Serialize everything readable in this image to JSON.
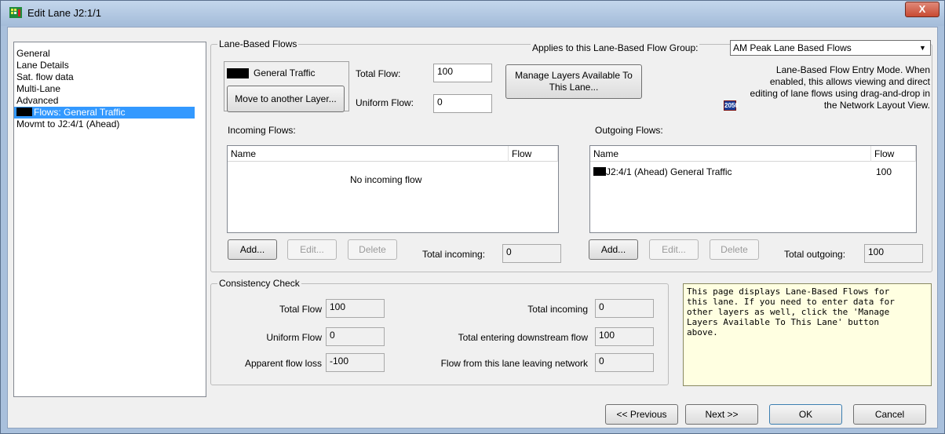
{
  "window": {
    "title": "Edit Lane J2:1/1",
    "close_glyph": "X",
    "app_icon": "junction-grid-icon"
  },
  "sidebar": {
    "items": [
      {
        "label": "General"
      },
      {
        "label": "Lane Details"
      },
      {
        "label": "Sat. flow data"
      },
      {
        "label": "Multi-Lane"
      },
      {
        "label": "Advanced"
      },
      {
        "label": "Flows: General Traffic",
        "selected": true
      },
      {
        "label": "Movmt to J2:4/1 (Ahead)"
      }
    ]
  },
  "lane_flows": {
    "group_title": "Lane-Based Flows",
    "applies_label": "Applies to this Lane-Based Flow Group:",
    "applies_value": "AM Peak Lane Based Flows",
    "layer_name": "General Traffic",
    "move_button": "Move to another Layer...",
    "total_flow_label": "Total Flow:",
    "total_flow_value": "100",
    "uniform_flow_label": "Uniform Flow:",
    "uniform_flow_value": "0",
    "manage_button": "Manage Layers Available To This Lane...",
    "mode_icon_text": "2050",
    "mode_text": "Lane-Based Flow Entry Mode. When enabled, this allows viewing and direct editing of lane flows using drag-and-drop in the Network Layout View."
  },
  "incoming": {
    "title": "Incoming Flows:",
    "columns": [
      "Name",
      "Flow"
    ],
    "empty_text": "No incoming flow",
    "add_button": "Add...",
    "edit_button": "Edit...",
    "delete_button": "Delete",
    "total_label": "Total incoming:",
    "total_value": "0"
  },
  "outgoing": {
    "title": "Outgoing Flows:",
    "columns": [
      "Name",
      "Flow"
    ],
    "rows": [
      {
        "name": "J2:4/1 (Ahead)  General Traffic",
        "flow": "100"
      }
    ],
    "add_button": "Add...",
    "edit_button": "Edit...",
    "delete_button": "Delete",
    "total_label": "Total outgoing:",
    "total_value": "100"
  },
  "consistency": {
    "title": "Consistency Check",
    "total_flow_label": "Total Flow",
    "total_flow_value": "100",
    "uniform_flow_label": "Uniform Flow",
    "uniform_flow_value": "0",
    "apparent_loss_label": "Apparent flow loss",
    "apparent_loss_value": "-100",
    "total_incoming_label": "Total incoming",
    "total_incoming_value": "0",
    "downstream_label": "Total entering downstream flow",
    "downstream_value": "100",
    "leaving_label": "Flow from this lane leaving network",
    "leaving_value": "0"
  },
  "help_note": "This page displays Lane-Based Flows for\nthis lane. If you need to enter data for\nother layers as well, click the 'Manage\nLayers Available To This Lane' button\nabove.",
  "footer": {
    "previous": "<< Previous",
    "next": "Next >>",
    "ok": "OK",
    "cancel": "Cancel"
  },
  "colors": {
    "selection": "#3399ff",
    "note_bg": "#ffffe1",
    "title_gradient_top": "#c4d6ec",
    "close_red": "#c84a32"
  }
}
